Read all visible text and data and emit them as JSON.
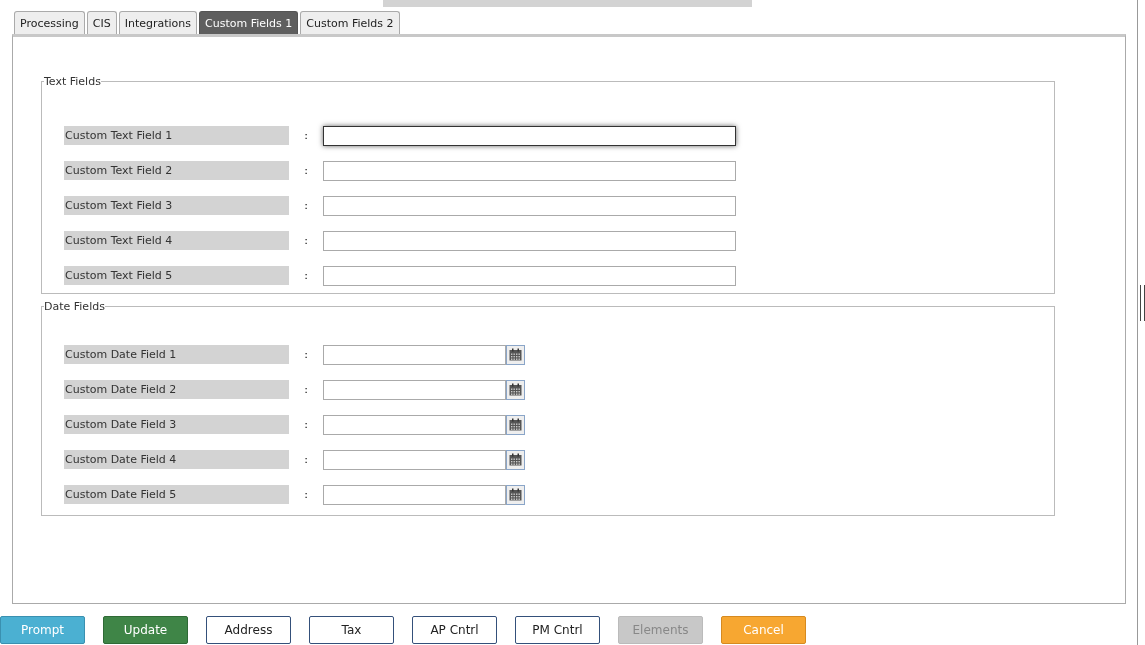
{
  "tabs": [
    {
      "label": "Processing",
      "selected": false
    },
    {
      "label": "CIS",
      "selected": false
    },
    {
      "label": "Integrations",
      "selected": false
    },
    {
      "label": "Custom Fields 1",
      "selected": true
    },
    {
      "label": "Custom Fields 2",
      "selected": false
    }
  ],
  "sections": [
    {
      "legend": "Text Fields",
      "kind": "text",
      "fields": [
        {
          "label": "Custom Text Field 1",
          "separator": ":",
          "focused": true
        },
        {
          "label": "Custom Text Field 2",
          "separator": ":",
          "focused": false
        },
        {
          "label": "Custom Text Field 3",
          "separator": ":",
          "focused": false
        },
        {
          "label": "Custom Text Field 4",
          "separator": ":",
          "focused": false
        },
        {
          "label": "Custom Text Field 5",
          "separator": ":",
          "focused": false
        }
      ]
    },
    {
      "legend": "Date Fields",
      "kind": "date",
      "fields": [
        {
          "label": "Custom Date Field 1",
          "separator": ":",
          "focused": false
        },
        {
          "label": "Custom Date Field 2",
          "separator": ":",
          "focused": false
        },
        {
          "label": "Custom Date Field 3",
          "separator": ":",
          "focused": false
        },
        {
          "label": "Custom Date Field 4",
          "separator": ":",
          "focused": false
        },
        {
          "label": "Custom Date Field 5",
          "separator": ":",
          "focused": false
        }
      ]
    }
  ],
  "buttons": [
    {
      "label": "Prompt",
      "kind": "info"
    },
    {
      "label": "Update",
      "kind": "success"
    },
    {
      "label": "Address",
      "kind": "default"
    },
    {
      "label": "Tax",
      "kind": "default"
    },
    {
      "label": "AP Cntrl",
      "kind": "default"
    },
    {
      "label": "PM Cntrl",
      "kind": "default"
    },
    {
      "label": "Elements",
      "kind": "disabled"
    },
    {
      "label": "Cancel",
      "kind": "warning"
    }
  ]
}
